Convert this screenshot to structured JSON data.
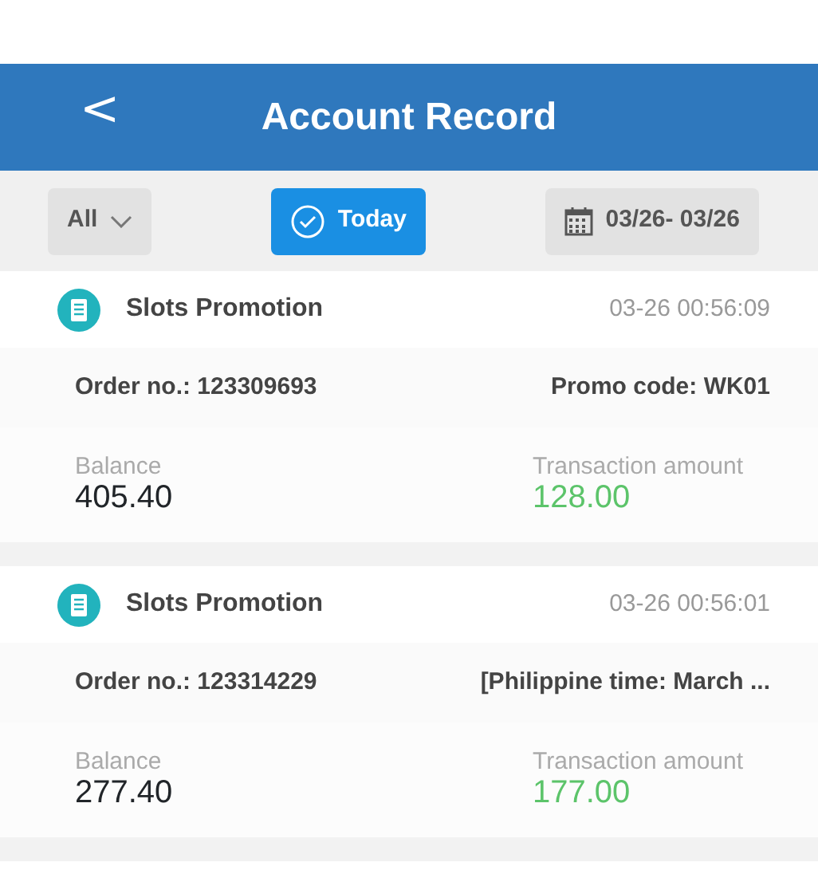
{
  "header": {
    "back": "<",
    "title": "Account Record"
  },
  "filters": {
    "type": {
      "label": "All"
    },
    "today": {
      "label": "Today",
      "selected": true
    },
    "date_range": {
      "label": "03/26- 03/26"
    }
  },
  "records": [
    {
      "title": "Slots Promotion",
      "time": "03-26 00:56:09",
      "order": "Order no.: 123309693",
      "note": "Promo code: WK01",
      "balance_label": "Balance",
      "balance": "405.40",
      "amount_label": "Transaction amount",
      "amount": "128.00"
    },
    {
      "title": "Slots Promotion",
      "time": "03-26 00:56:01",
      "order": "Order no.: 123314229",
      "note": "[Philippine time: March ...",
      "balance_label": "Balance",
      "balance": "277.40",
      "amount_label": "Transaction amount",
      "amount": "177.00"
    }
  ]
}
